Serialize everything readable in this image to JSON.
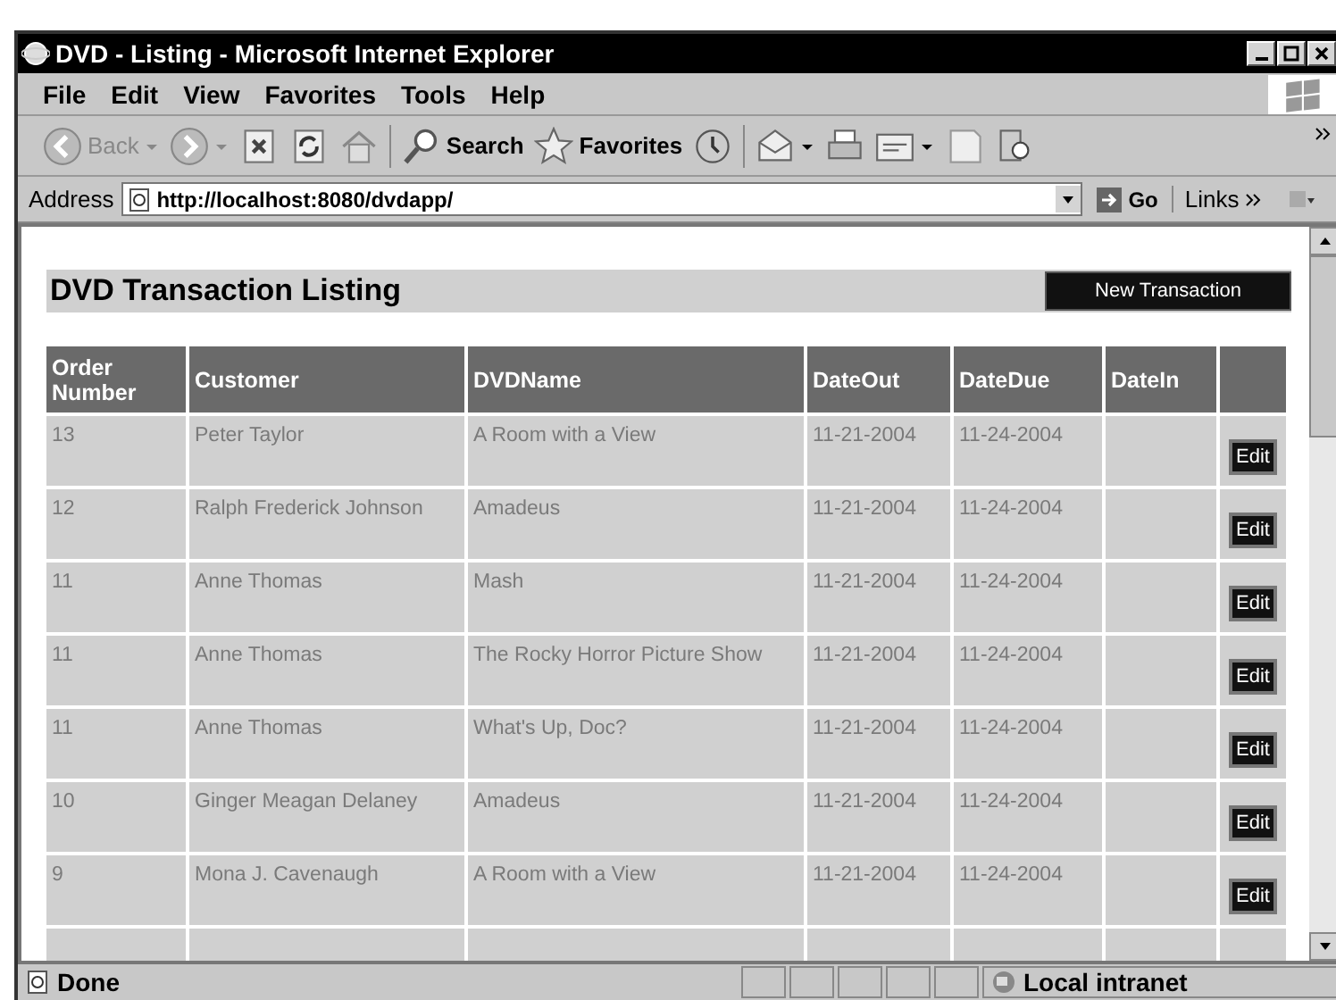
{
  "window": {
    "title": "DVD - Listing - Microsoft Internet Explorer"
  },
  "menu": [
    "File",
    "Edit",
    "View",
    "Favorites",
    "Tools",
    "Help"
  ],
  "toolbar": [
    {
      "kind": "back",
      "label": "Back",
      "disabled": true
    },
    {
      "kind": "forward",
      "disabled": true
    },
    {
      "kind": "stop"
    },
    {
      "kind": "refresh"
    },
    {
      "kind": "home"
    },
    {
      "kind": "search",
      "label": "Search"
    },
    {
      "kind": "favorites",
      "label": "Favorites"
    },
    {
      "kind": "history"
    },
    {
      "kind": "mail"
    },
    {
      "kind": "print"
    },
    {
      "kind": "edit"
    },
    {
      "kind": "discuss"
    },
    {
      "kind": "research"
    }
  ],
  "address": {
    "label": "Address",
    "value": "http://localhost:8080/dvdapp/",
    "go": "Go",
    "links": "Links"
  },
  "page": {
    "title": "DVD Transaction Listing",
    "new_button": "New Transaction"
  },
  "table": {
    "columns": [
      "Order Number",
      "Customer",
      "DVDName",
      "DateOut",
      "DateDue",
      "DateIn"
    ],
    "rows": [
      {
        "cells": [
          "13",
          "Peter Taylor",
          "A Room with a View",
          "11-21-2004",
          "11-24-2004",
          ""
        ],
        "action": "Edit"
      },
      {
        "cells": [
          "12",
          "Ralph Frederick Johnson",
          "Amadeus",
          "11-21-2004",
          "11-24-2004",
          ""
        ],
        "action": "Edit"
      },
      {
        "cells": [
          "11",
          "Anne Thomas",
          "Mash",
          "11-21-2004",
          "11-24-2004",
          ""
        ],
        "action": "Edit"
      },
      {
        "cells": [
          "11",
          "Anne Thomas",
          "The Rocky Horror Picture Show",
          "11-21-2004",
          "11-24-2004",
          ""
        ],
        "action": "Edit"
      },
      {
        "cells": [
          "11",
          "Anne Thomas",
          "What's Up, Doc?",
          "11-21-2004",
          "11-24-2004",
          ""
        ],
        "action": "Edit"
      },
      {
        "cells": [
          "10",
          "Ginger Meagan Delaney",
          "Amadeus",
          "11-21-2004",
          "11-24-2004",
          ""
        ],
        "action": "Edit"
      },
      {
        "cells": [
          "9",
          "Mona J. Cavenaugh",
          "A Room with a View",
          "11-21-2004",
          "11-24-2004",
          ""
        ],
        "action": "Edit"
      }
    ]
  },
  "status_bar": {
    "text": "Done",
    "zone": "Local intranet"
  }
}
